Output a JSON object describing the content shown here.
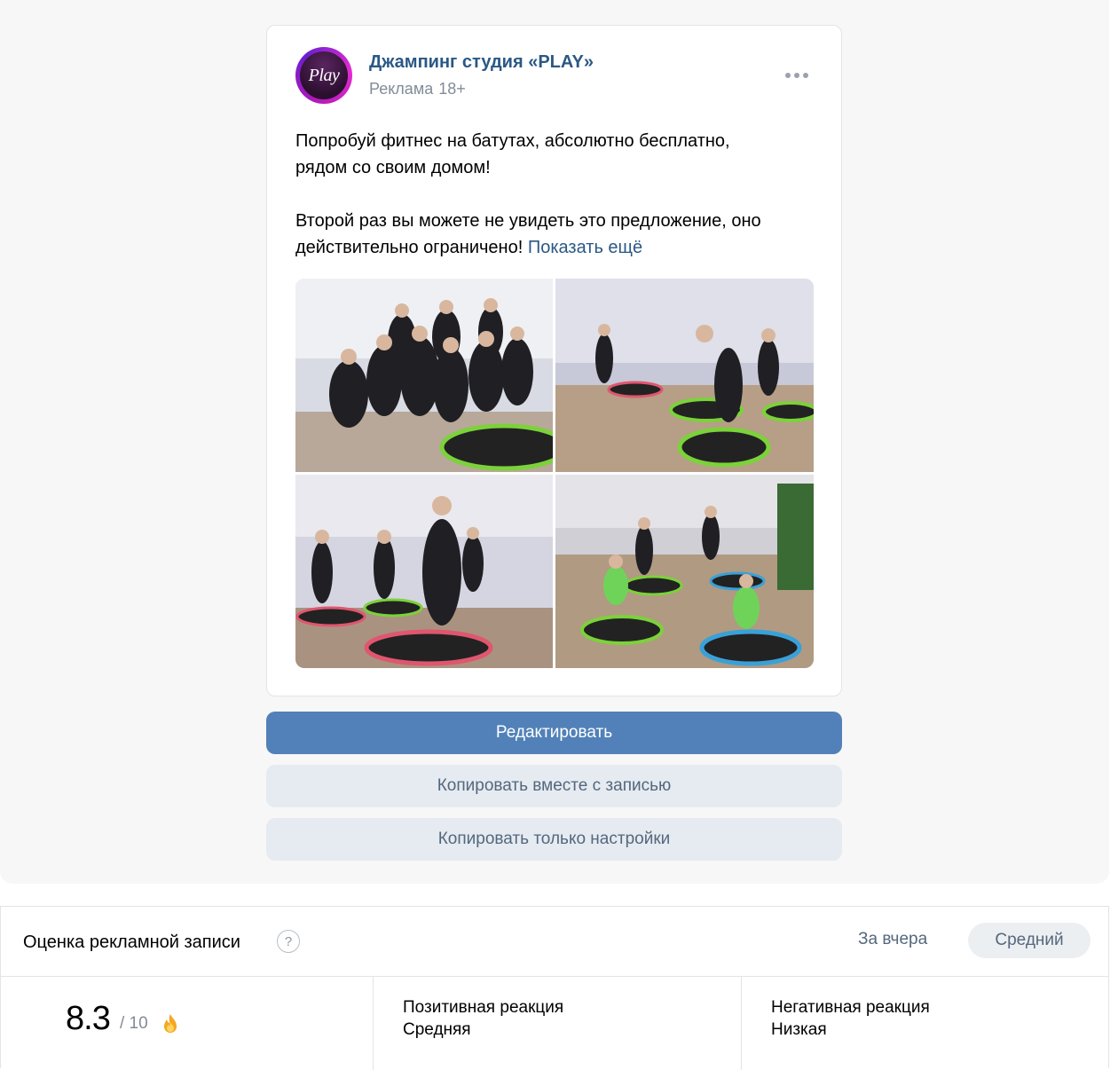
{
  "post": {
    "author": "Джампинг студия «PLAY»",
    "avatar_text": "Play",
    "label": "Реклама",
    "age_rating": "18+",
    "text_line1": "Попробуй фитнес на батутах, абсолютно бесплатно,",
    "text_line2": "рядом со своим домом!",
    "text_line3": "Второй раз вы можете не увидеть это предложение, оно",
    "text_line4": "действительно ограничено!",
    "show_more": "Показать ещё"
  },
  "buttons": {
    "edit": "Редактировать",
    "copy_with_post": "Копировать вместе с записью",
    "copy_settings": "Копировать только настройки"
  },
  "score": {
    "title": "Оценка рекламной записи",
    "help": "?",
    "period_link": "За вчера",
    "period_chip": "Средний",
    "value": "8.3",
    "max": "/ 10",
    "positive_label": "Позитивная реакция",
    "positive_value": "Средняя",
    "negative_label": "Негативная реакция",
    "negative_value": "Низкая"
  },
  "colors": {
    "link": "#2a5885",
    "primary_button": "#5181b8",
    "secondary_button": "#e5ebf1",
    "trampoline_green": "#7bd23a",
    "trampoline_pink": "#e0566f"
  }
}
